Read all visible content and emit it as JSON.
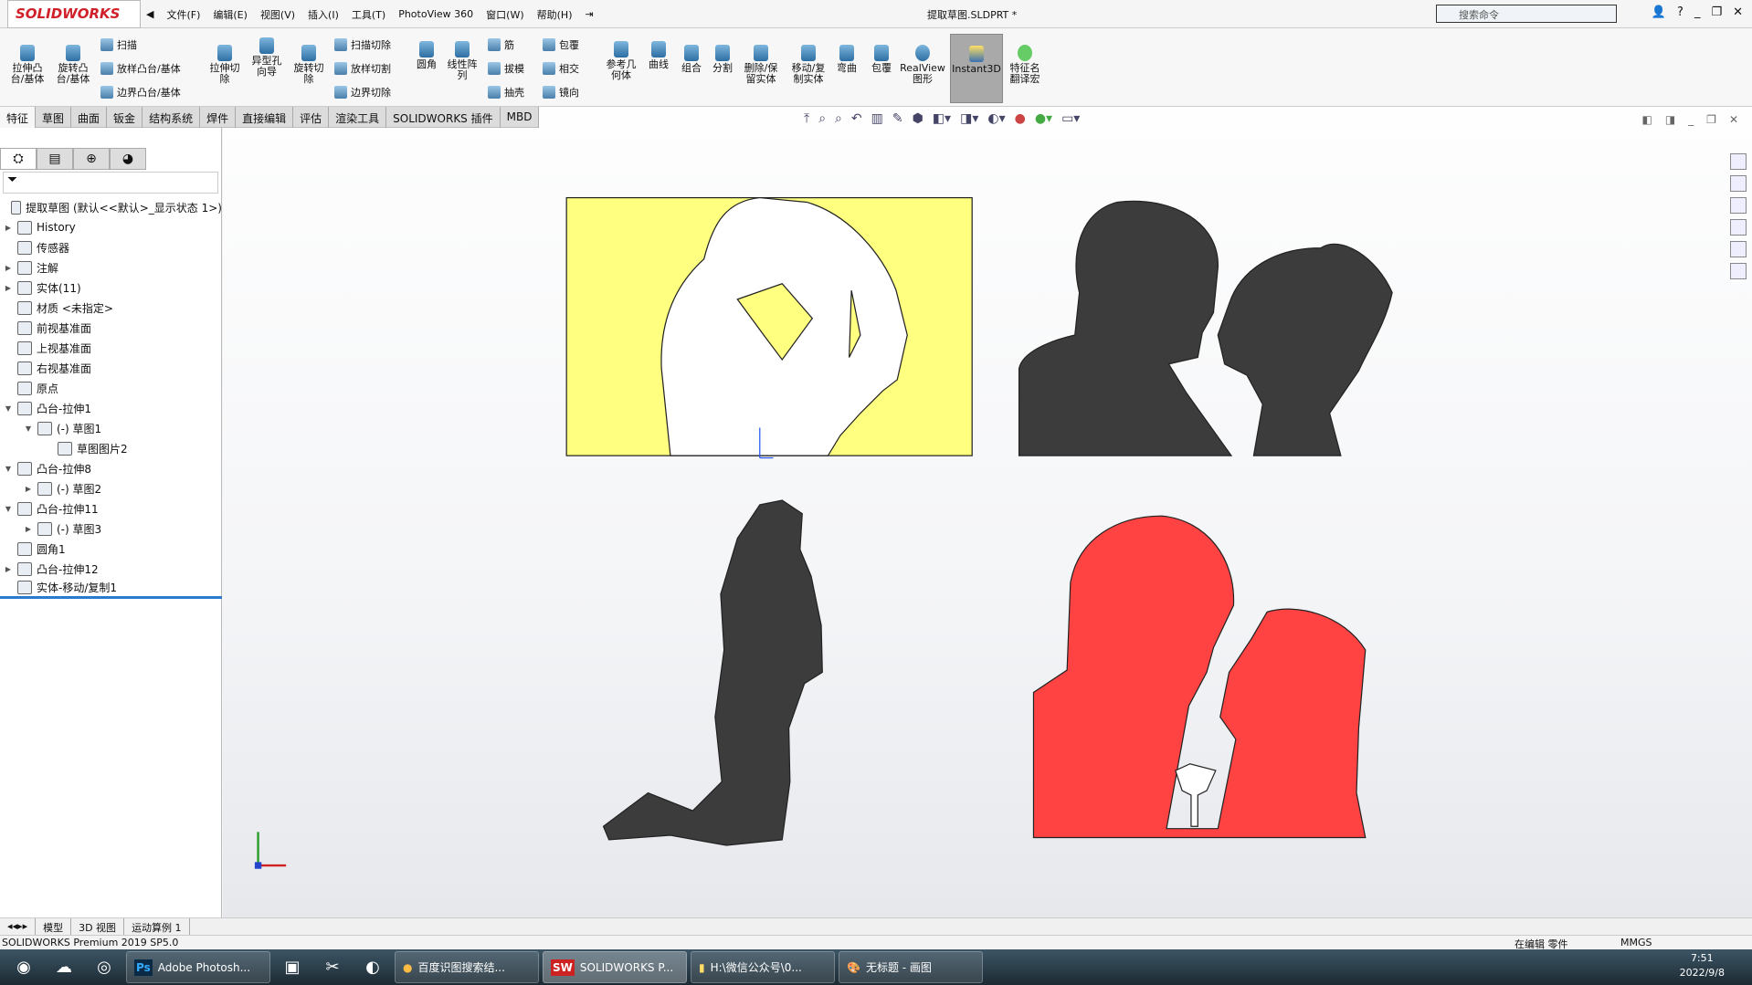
{
  "app": {
    "logo": "SOLIDWORKS",
    "title": "提取草图.SLDPRT *",
    "search_placeholder": "搜索命令"
  },
  "menu": [
    "文件(F)",
    "编辑(E)",
    "视图(V)",
    "插入(I)",
    "工具(T)",
    "PhotoView 360",
    "窗口(W)",
    "帮助(H)"
  ],
  "ribbon": {
    "large": [
      "拉伸凸\n台/基体",
      "旋转凸\n台/基体",
      "拉伸切\n除",
      "异型孔\n向导",
      "旋转切\n除",
      "圆角",
      "线性阵\n列",
      "参考几\n何体",
      "曲线",
      "组合",
      "分割",
      "删除/保\n留实体",
      "移动/复\n制实体",
      "弯曲",
      "包覆",
      "RealView\n图形",
      "Instant3D",
      "特征名\n翻译宏"
    ],
    "small": [
      "扫描",
      "放样凸台/基体",
      "边界凸台/基体",
      "扫描切除",
      "放样切割",
      "边界切除",
      "筋",
      "拔模",
      "抽壳",
      "包覆",
      "相交",
      "镜向"
    ]
  },
  "tabs": [
    "特征",
    "草图",
    "曲面",
    "钣金",
    "结构系统",
    "焊件",
    "直接编辑",
    "评估",
    "渲染工具",
    "SOLIDWORKS 插件",
    "MBD"
  ],
  "tree": [
    {
      "label": "提取草图 (默认<<默认>_显示状态 1>)",
      "level": 0,
      "arrow": ""
    },
    {
      "label": "History",
      "level": 1,
      "arrow": "▶"
    },
    {
      "label": "传感器",
      "level": 1,
      "arrow": ""
    },
    {
      "label": "注解",
      "level": 1,
      "arrow": "▶"
    },
    {
      "label": "实体(11)",
      "level": 1,
      "arrow": "▶"
    },
    {
      "label": "材质 <未指定>",
      "level": 1,
      "arrow": ""
    },
    {
      "label": "前视基准面",
      "level": 1,
      "arrow": ""
    },
    {
      "label": "上视基准面",
      "level": 1,
      "arrow": ""
    },
    {
      "label": "右视基准面",
      "level": 1,
      "arrow": ""
    },
    {
      "label": "原点",
      "level": 1,
      "arrow": ""
    },
    {
      "label": "凸台-拉伸1",
      "level": 1,
      "arrow": "▼"
    },
    {
      "label": "(-) 草图1",
      "level": 2,
      "arrow": "▼"
    },
    {
      "label": "草图图片2",
      "level": 3,
      "arrow": ""
    },
    {
      "label": "凸台-拉伸8",
      "level": 1,
      "arrow": "▼"
    },
    {
      "label": "(-) 草图2",
      "level": 2,
      "arrow": "▶"
    },
    {
      "label": "凸台-拉伸11",
      "level": 1,
      "arrow": "▼"
    },
    {
      "label": "(-) 草图3",
      "level": 2,
      "arrow": "▶"
    },
    {
      "label": "圆角1",
      "level": 1,
      "arrow": ""
    },
    {
      "label": "凸台-拉伸12",
      "level": 1,
      "arrow": "▶"
    },
    {
      "label": "实体-移动/复制1",
      "level": 1,
      "arrow": ""
    }
  ],
  "model_tabs": [
    "模型",
    "3D 视图",
    "运动算例 1"
  ],
  "status": {
    "left": "SOLIDWORKS Premium 2019 SP5.0",
    "mode": "在编辑 零件",
    "units": "MMGS"
  },
  "taskbar": {
    "items": [
      "Adobe Photosh...",
      "百度识图搜索结...",
      "SOLIDWORKS P...",
      "H:\\微信公众号\\0...",
      "无标题 - 画图"
    ],
    "time": "7:51",
    "date": "2022/9/8"
  },
  "colors": {
    "yellow": "#ffff80",
    "dark": "#3c3c3c",
    "red": "#ff4040",
    "accent": "#2a7bd0"
  }
}
